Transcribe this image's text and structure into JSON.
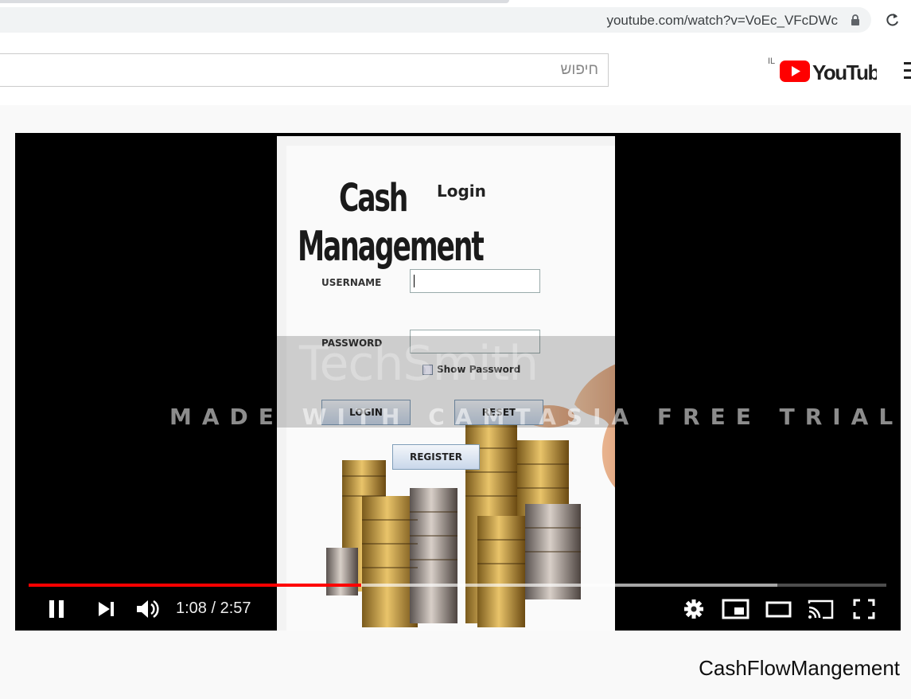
{
  "browser": {
    "url": "youtube.com/watch?v=VoEc_VFcDWc"
  },
  "header": {
    "search_placeholder": "חיפוש",
    "country_code": "IL",
    "logo_text": "YouTube"
  },
  "player": {
    "time_display": "1:08 / 2:57",
    "played_fraction": 0.388,
    "buffered_fraction": 0.873,
    "progress_color": "#ff0000"
  },
  "video_content": {
    "brand_line1": "Cash",
    "brand_line2": "Management",
    "login_title": "Login",
    "username_label": "USERNAME",
    "password_label": "PASSWORD",
    "show_password_label": "Show Password",
    "login_button": "LOGIN",
    "reset_button": "RESET",
    "register_button": "REGISTER",
    "watermark_brand": "TechSmith",
    "watermark_text": "MADE WITH CAMTASIA FREE TRIAL"
  },
  "video_title": "CashFlowMangement"
}
